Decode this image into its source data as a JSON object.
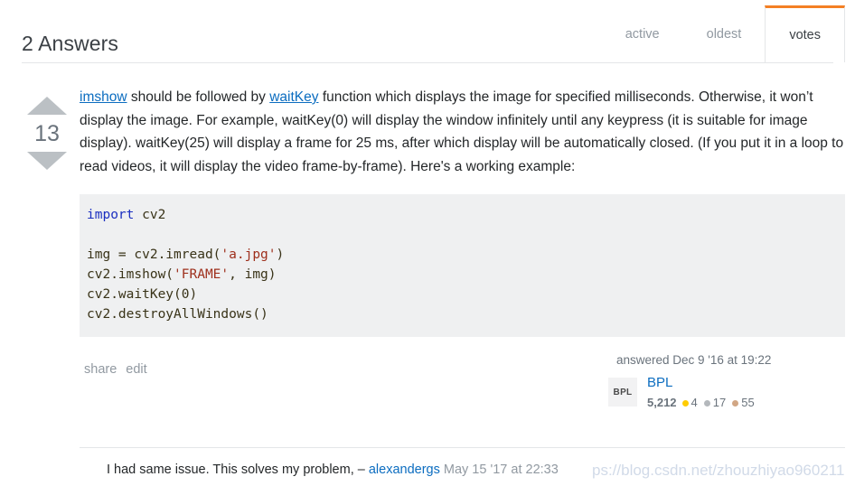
{
  "header": {
    "title": "2 Answers",
    "tabs": [
      {
        "label": "active",
        "selected": false
      },
      {
        "label": "oldest",
        "selected": false
      },
      {
        "label": "votes",
        "selected": true
      }
    ]
  },
  "answer": {
    "vote_count": "13",
    "body": {
      "link1": "imshow",
      "segment1": " should be followed by ",
      "link2": "waitKey",
      "segment2": " function which displays the image for specified milliseconds. Otherwise, it won’t display the image. For example, waitKey(0) will display the window infinitely until any keypress (it is suitable for image display). waitKey(25) will display a frame for 25 ms, after which display will be automatically closed. (If you put it in a loop to read videos, it will display the video frame-by-frame). Here's a working example:"
    },
    "code": {
      "language": "python",
      "lines": [
        [
          {
            "t": "import",
            "c": "kw"
          },
          {
            "t": " cv2",
            "c": "plain"
          }
        ],
        [
          {
            "t": "",
            "c": "plain"
          }
        ],
        [
          {
            "t": "img = cv2.imread(",
            "c": "plain"
          },
          {
            "t": "'a.jpg'",
            "c": "str"
          },
          {
            "t": ")",
            "c": "plain"
          }
        ],
        [
          {
            "t": "cv2.imshow(",
            "c": "plain"
          },
          {
            "t": "'FRAME'",
            "c": "str"
          },
          {
            "t": ", img)",
            "c": "plain"
          }
        ],
        [
          {
            "t": "cv2.waitKey(0)",
            "c": "plain"
          }
        ],
        [
          {
            "t": "cv2.destroyAllWindows()",
            "c": "plain"
          }
        ]
      ],
      "plain_text": "import cv2\n\nimg = cv2.imread('a.jpg')\ncv2.imshow('FRAME', img)\ncv2.waitKey(0)\ncv2.destroyAllWindows()"
    },
    "menu": {
      "share_label": "share",
      "edit_label": "edit"
    },
    "user_card": {
      "answered_label": "answered Dec 9 '16 at 19:22",
      "avatar_initials": "BPL",
      "user_name": "BPL",
      "reputation": "5,212",
      "badges": [
        {
          "type": "gold",
          "count": "4",
          "color": "#ffcc01"
        },
        {
          "type": "silver",
          "count": "17",
          "color": "#b4b8bc"
        },
        {
          "type": "bronze",
          "count": "55",
          "color": "#d1a684"
        }
      ]
    }
  },
  "comments": [
    {
      "text": "I had same issue. This solves my problem, – ",
      "user": "alexandergs",
      "date": " May 15 '17 at 22:33"
    }
  ],
  "watermark": {
    "text": "ps://blog.csdn.net/zhouzhiyao960211"
  },
  "colors": {
    "accent_orange": "#f48024",
    "link_blue": "#0c6dc0",
    "muted_gray": "#9199a1",
    "code_bg": "#eff0f1"
  }
}
